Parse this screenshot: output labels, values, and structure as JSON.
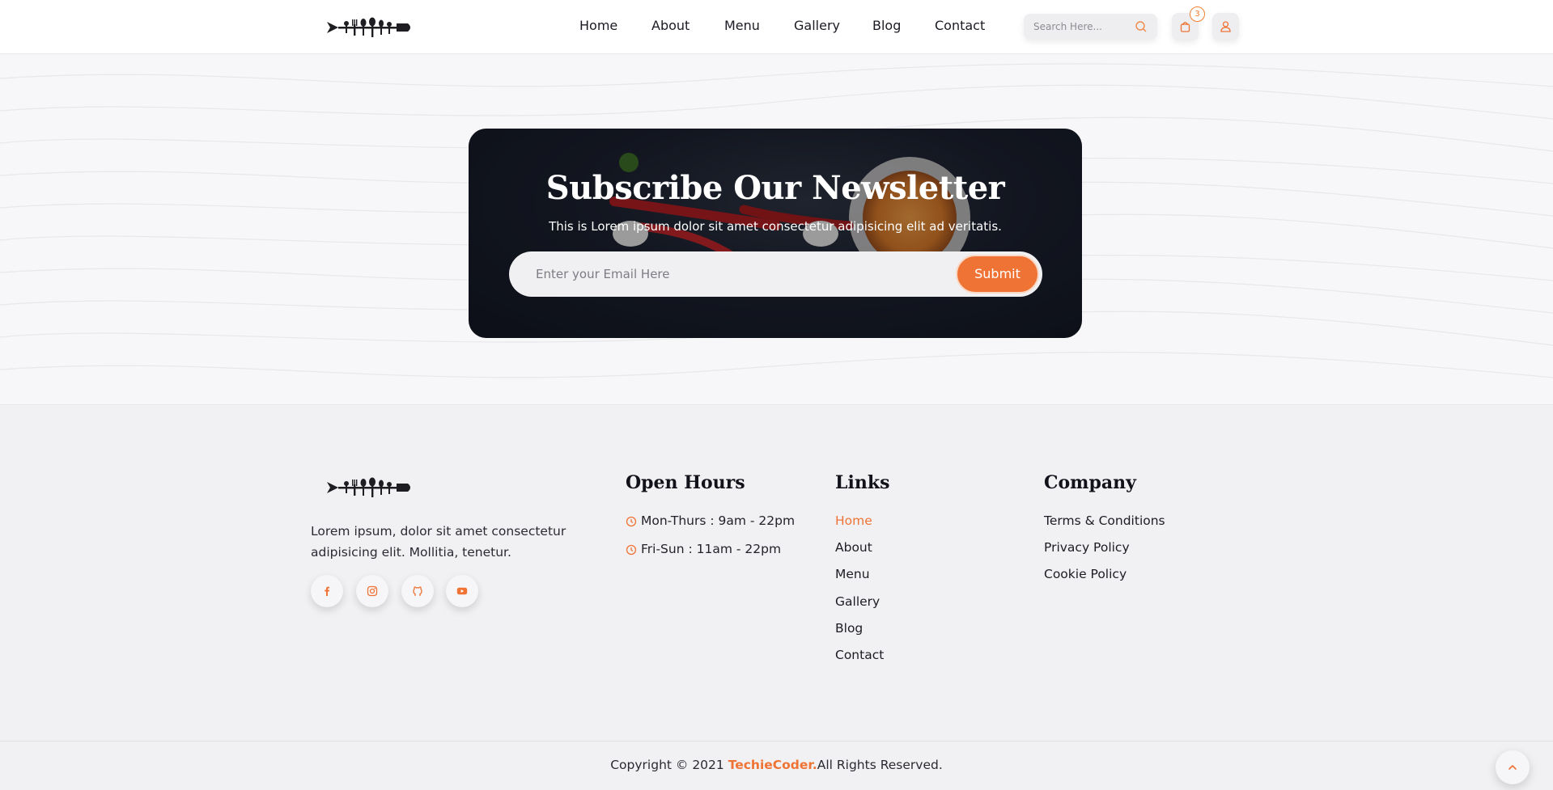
{
  "header": {
    "nav": [
      {
        "label": "Home"
      },
      {
        "label": "About"
      },
      {
        "label": "Menu"
      },
      {
        "label": "Gallery"
      },
      {
        "label": "Blog"
      },
      {
        "label": "Contact"
      }
    ],
    "search": {
      "placeholder": "Search Here...",
      "value": ""
    },
    "cart": {
      "count": "3"
    }
  },
  "newsletter": {
    "title": "Subscribe Our Newsletter",
    "subtitle": "This is Lorem ipsum dolor sit amet consectetur adipisicing elit ad veritatis.",
    "email_placeholder": "Enter your Email Here",
    "submit_label": "Submit"
  },
  "footer": {
    "about": "Lorem ipsum, dolor sit amet consectetur adipisicing elit. Mollitia, tenetur.",
    "social": [
      {
        "icon": "facebook-icon"
      },
      {
        "icon": "instagram-icon"
      },
      {
        "icon": "github-icon"
      },
      {
        "icon": "youtube-icon"
      }
    ],
    "open_hours": {
      "title": "Open Hours",
      "lines": [
        "Mon-Thurs : 9am - 22pm",
        "Fri-Sun : 11am - 22pm"
      ]
    },
    "links": {
      "title": "Links",
      "items": [
        "Home",
        "About",
        "Menu",
        "Gallery",
        "Blog",
        "Contact"
      ]
    },
    "company": {
      "title": "Company",
      "items": [
        "Terms & Conditions",
        "Privacy Policy",
        "Cookie Policy"
      ]
    }
  },
  "copyright": {
    "prefix": "Copyright © 2021 ",
    "brand": "TechieCoder.",
    "suffix": "All Rights Reserved."
  },
  "colors": {
    "accent": "#ef7335",
    "dark_card": "#141823",
    "background": "#f3f3f5"
  }
}
